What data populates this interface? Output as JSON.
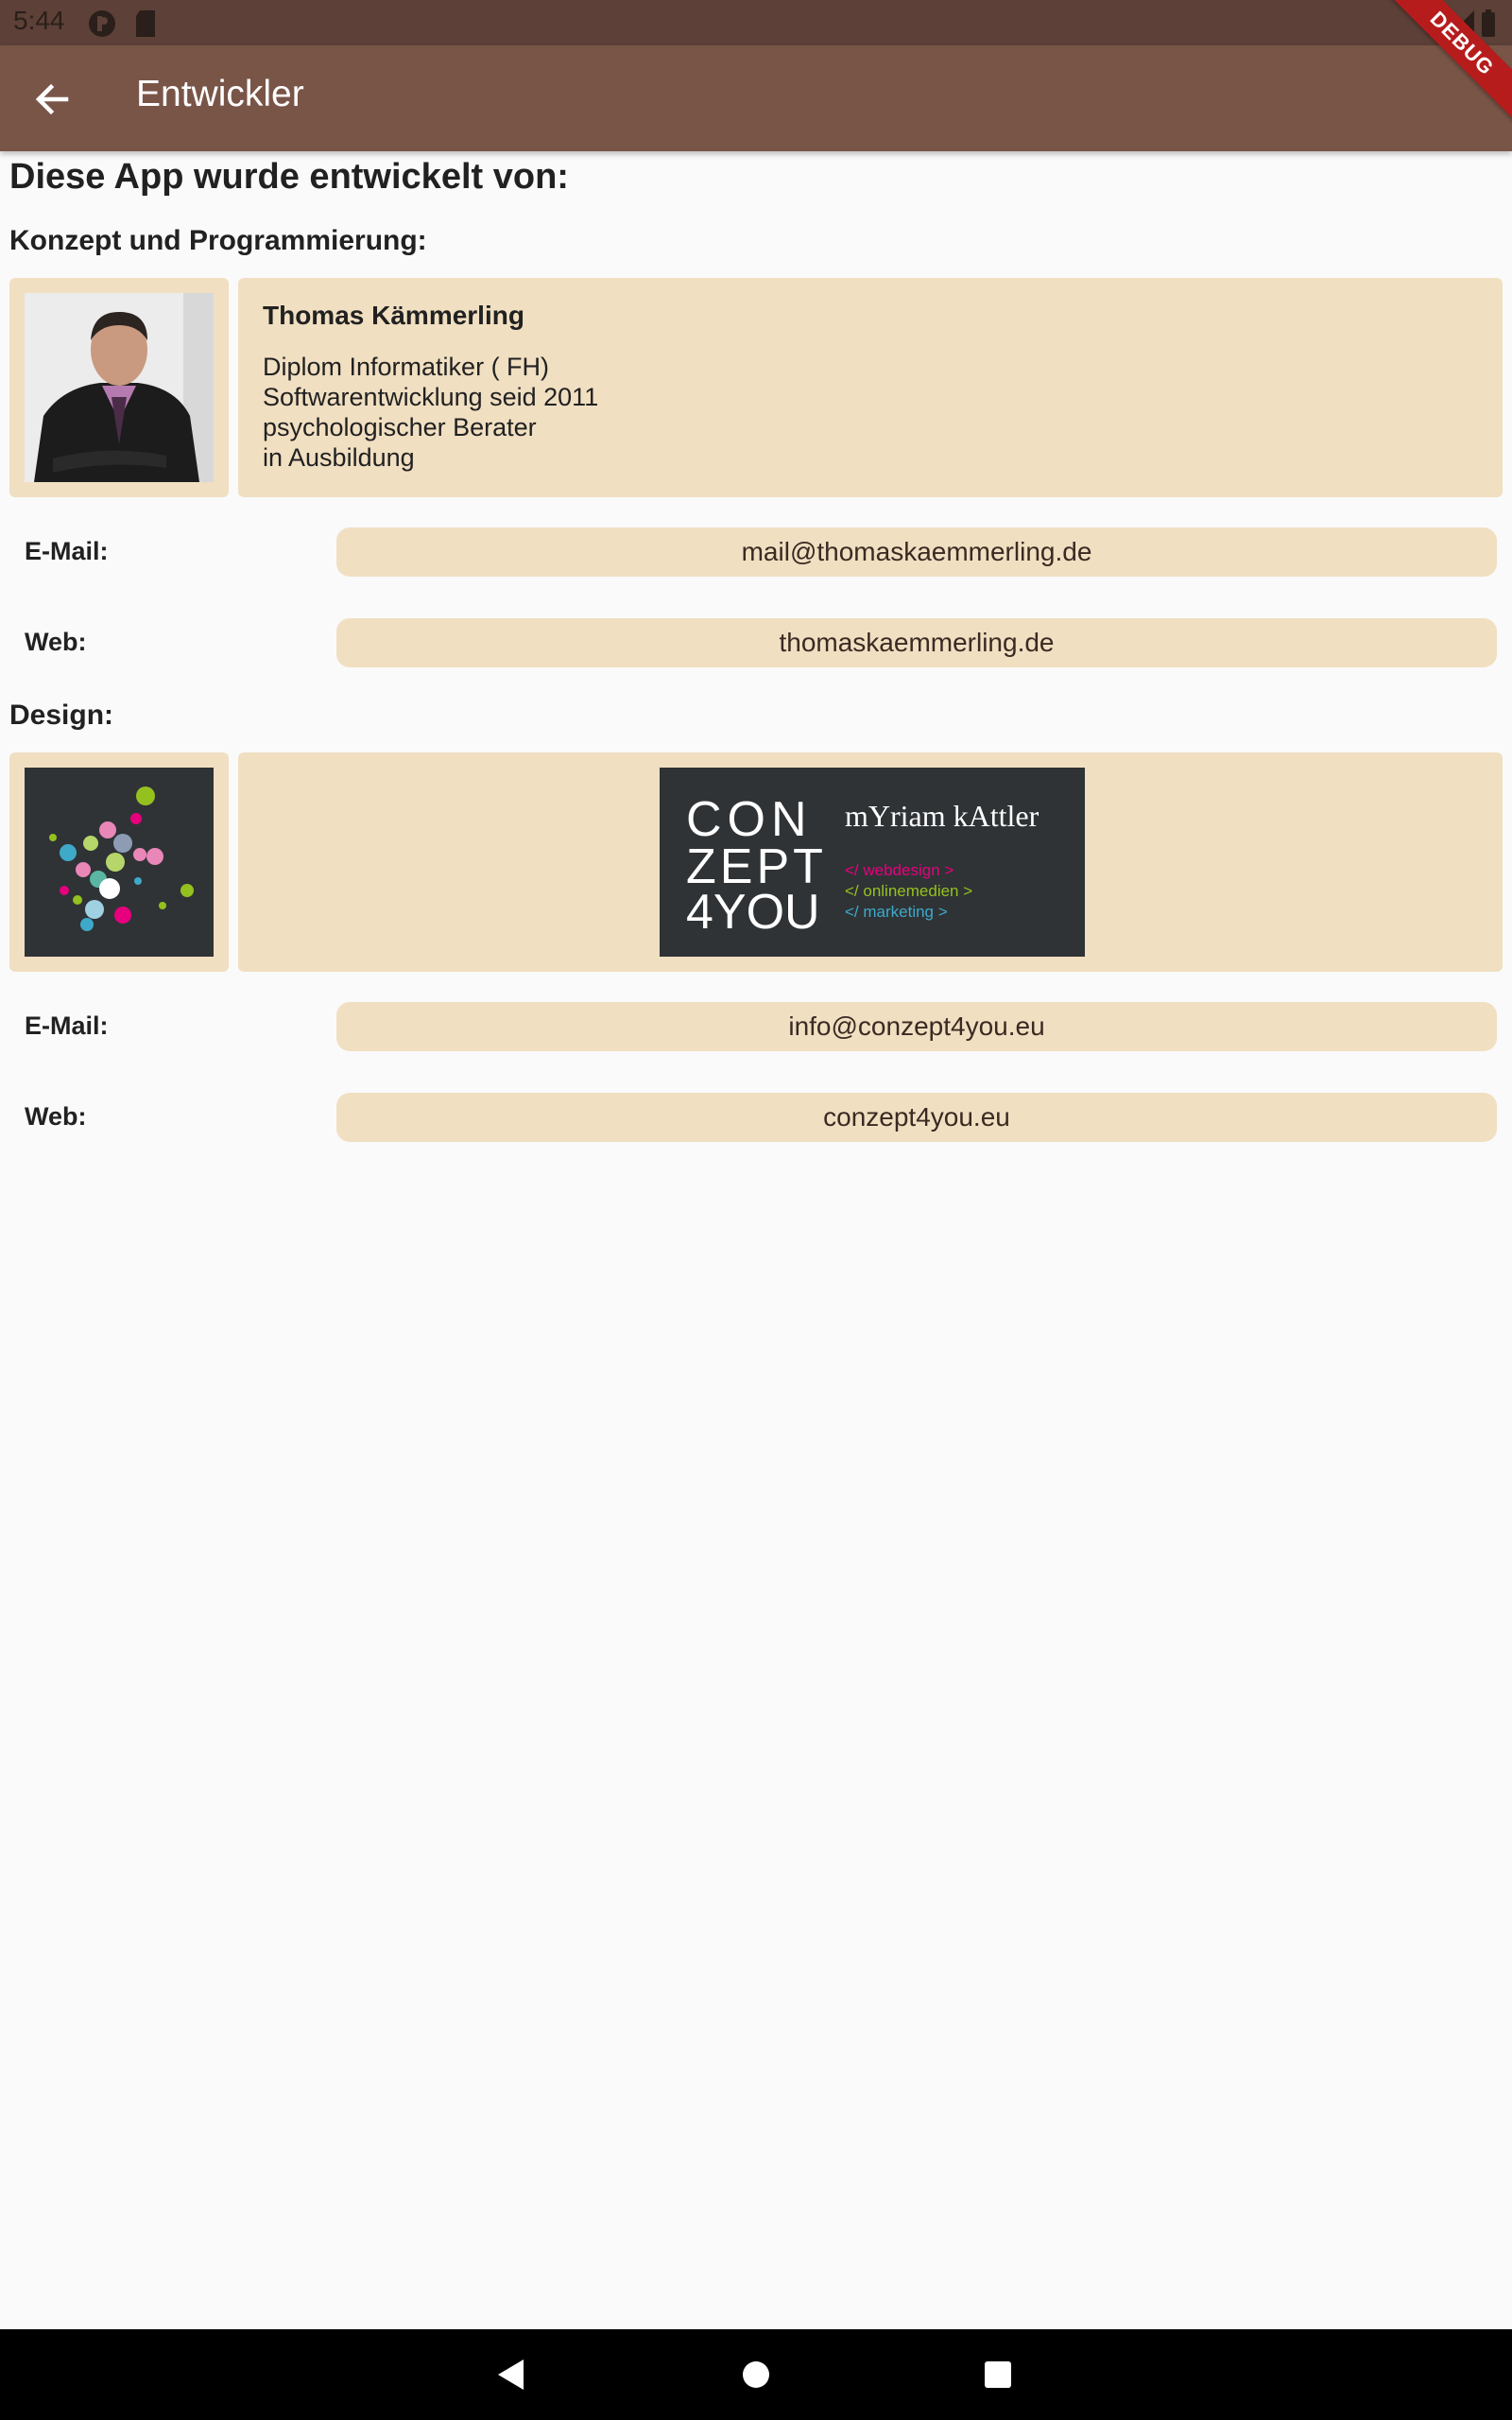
{
  "status_bar": {
    "time": "5:44"
  },
  "appbar": {
    "title": "Entwickler",
    "debug_label": "DEBUG"
  },
  "page": {
    "heading": "Diese App wurde entwickelt von:",
    "section_concept": "Konzept und Programmierung:",
    "section_design": "Design:"
  },
  "developer": {
    "name": "Thomas Kämmerling",
    "lines": [
      "Diplom Informatiker ( FH)",
      "Softwarentwicklung seid 2011",
      "psychologischer Berater",
      "in Ausbildung"
    ],
    "email_label": "E-Mail:",
    "email": "mail@thomaskaemmerling.de",
    "web_label": "Web:",
    "web": "thomaskaemmerling.de"
  },
  "designer": {
    "logo_text": {
      "line1": "CON",
      "line2": "ZEPT",
      "line3": "4YOU",
      "name": "mYriam kAttler",
      "tag1": "</ webdesign >",
      "tag2": "</ onlinemedien >",
      "tag3": "</ marketing >"
    },
    "email_label": "E-Mail:",
    "email": "info@conzept4you.eu",
    "web_label": "Web:",
    "web": "conzept4you.eu"
  },
  "colors": {
    "appbar": "#795548",
    "status_bar": "#5d4037",
    "card": "#f1dfc2",
    "tag1": "#e6007e",
    "tag2": "#95c11f",
    "tag3": "#3fa9c9"
  }
}
